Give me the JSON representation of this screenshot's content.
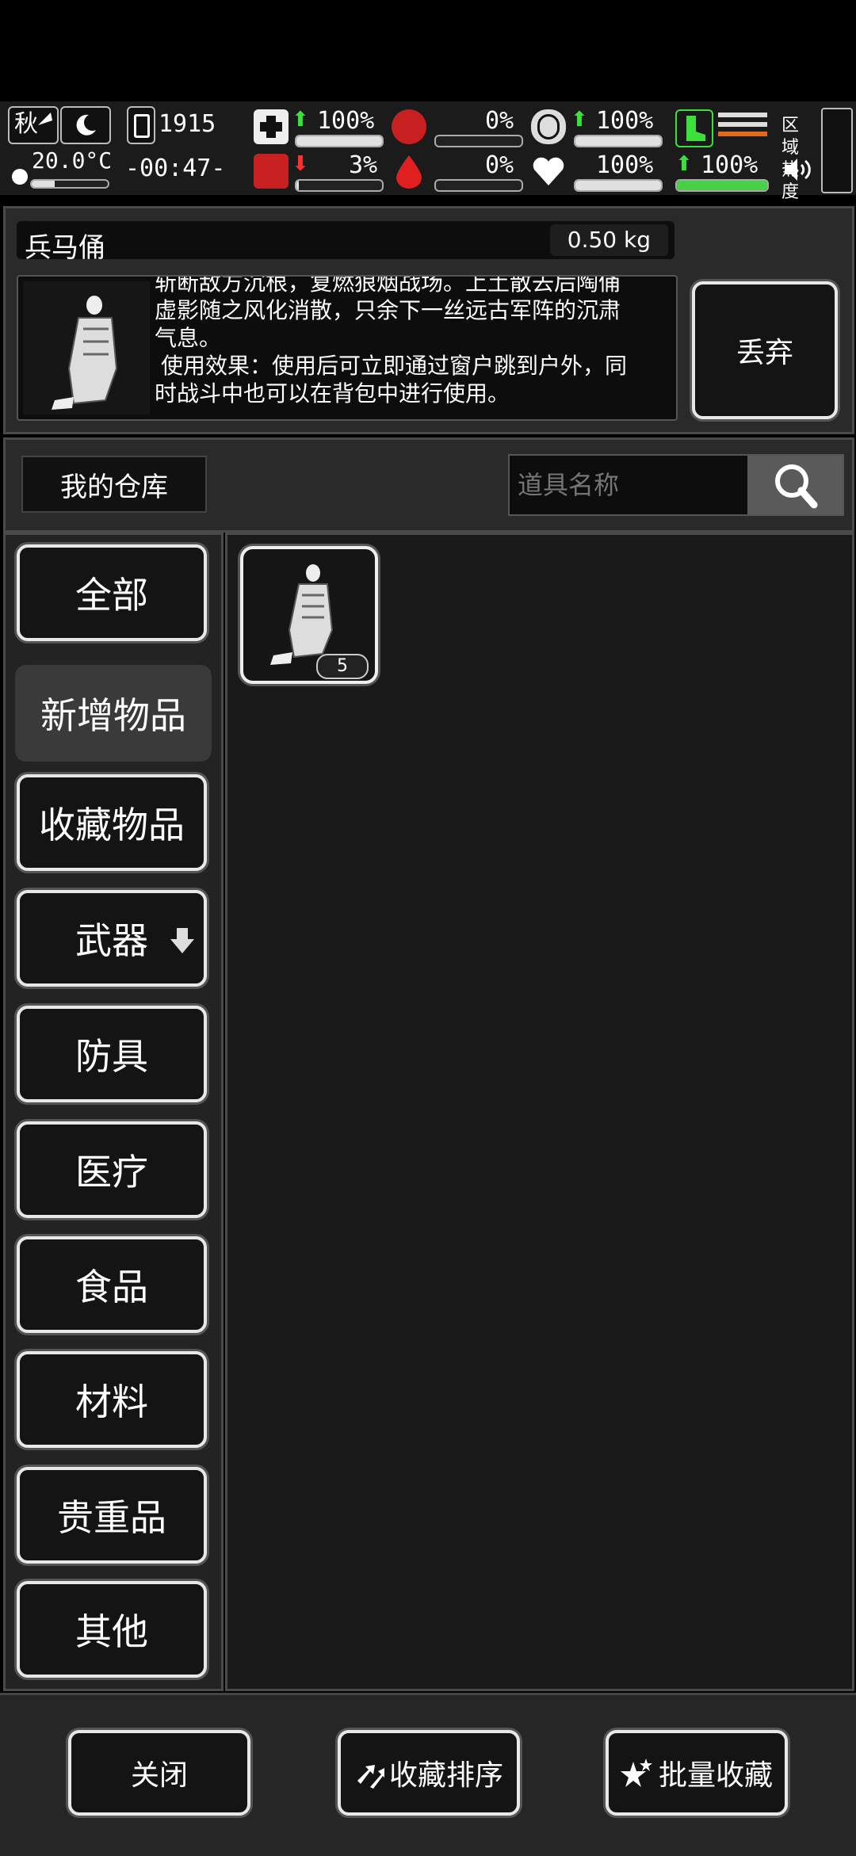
{
  "status": {
    "season": "秋",
    "temperature": "20.0°C",
    "day": "1915",
    "time": "-00:47-",
    "stats": [
      {
        "value": "100%",
        "fill": 1.0,
        "trend": "up"
      },
      {
        "value": "0%",
        "fill": 0.0
      },
      {
        "value": "100%",
        "fill": 1.0,
        "trend": "up"
      },
      {
        "value": "3%",
        "fill": 0.03,
        "trend": "down"
      },
      {
        "value": "0%",
        "fill": 0.0
      },
      {
        "value": "100%",
        "fill": 1.0
      },
      {
        "value": "100%",
        "fill": 1.0,
        "trend": "up"
      }
    ],
    "zone_label": "区域热度"
  },
  "item": {
    "name": "兵马俑",
    "weight": "0.50 kg",
    "desc_line1": "斩断敌方沉根，复燃狼烟战场。上土散去后陶俑",
    "desc_line2": "虚影随之风化消散，只余下一丝远古军阵的沉肃",
    "desc_line3": "气息。",
    "desc_line4": "使用效果：使用后可立即通过窗户跳到户外，同",
    "desc_line5": "时战斗中也可以在背包中进行使用。",
    "discard": "丢弃"
  },
  "warehouse": {
    "title": "我的仓库",
    "search_placeholder": "道具名称"
  },
  "categories": [
    "全部",
    "新增物品",
    "收藏物品",
    "武器",
    "防具",
    "医疗",
    "食品",
    "材料",
    "贵重品",
    "其他"
  ],
  "grid": {
    "item_count": "5"
  },
  "footer": {
    "close": "关闭",
    "sort": "收藏排序",
    "batch": "批量收藏"
  },
  "colors": {
    "accent_green": "#3be03b",
    "alert_red": "#ff3030",
    "panel_bg": "#2a2a2a"
  }
}
